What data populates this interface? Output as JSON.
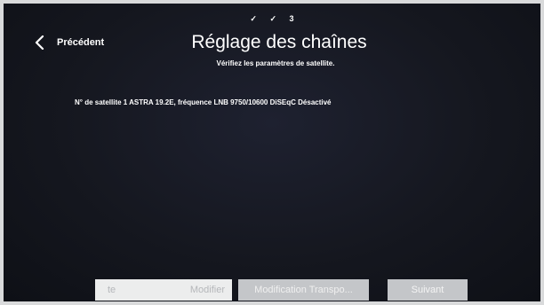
{
  "steps": {
    "step1": "✓",
    "step2": "✓",
    "step3": "3"
  },
  "header": {
    "back_label": "Précédent",
    "title": "Réglage des chaînes",
    "subtitle": "Vérifiez les paramètres de satellite."
  },
  "content": {
    "satellite_info": "N° de satellite 1 ASTRA 19.2E, fréquence LNB 9750/10600 DiSEqC Désactivé"
  },
  "buttons": {
    "input_value": "te",
    "modify_label": "Modifier",
    "transponder_label": "Modification Transpo...",
    "next_label": "Suivant"
  },
  "colors": {
    "background": "#15171f",
    "text": "#ffffff",
    "button_light": "#e8e9ea",
    "button_dim": "#c4c6c9"
  }
}
